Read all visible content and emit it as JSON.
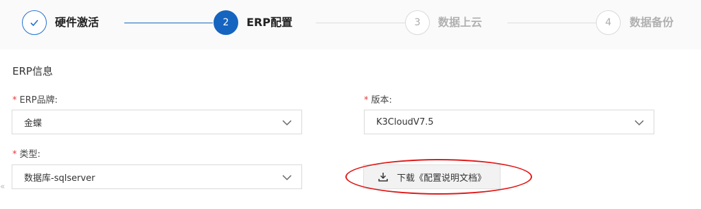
{
  "steps": [
    {
      "number": "",
      "label": "硬件激活",
      "status": "done"
    },
    {
      "number": "2",
      "label": "ERP配置",
      "status": "active"
    },
    {
      "number": "3",
      "label": "数据上云",
      "status": "pending"
    },
    {
      "number": "4",
      "label": "数据备份",
      "status": "pending"
    }
  ],
  "section": {
    "title": "ERP信息"
  },
  "form": {
    "required_mark": "*",
    "erp_brand": {
      "label": "ERP品牌:",
      "value": "金蝶"
    },
    "version": {
      "label": "版本:",
      "value": "K3CloudV7.5"
    },
    "type": {
      "label": "类型:",
      "value": "数据库-sqlserver"
    }
  },
  "download_button": {
    "label": "下载《配置说明文档》"
  },
  "side_arrow": {
    "glyph": "«"
  },
  "colors": {
    "primary": "#1565c0",
    "required": "#e4393c",
    "annotation": "#e01818"
  },
  "icons": {
    "done_step": "check-icon",
    "select": "chevron-down-icon",
    "download": "download-icon"
  }
}
